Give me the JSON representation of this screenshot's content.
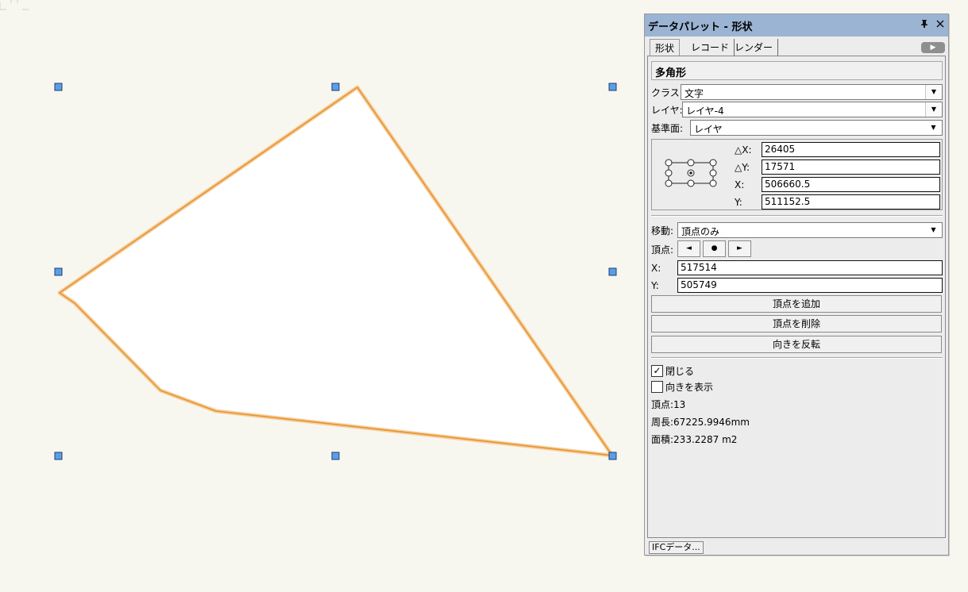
{
  "palette": {
    "title": "データパレット - 形状",
    "pin_icon": "pin-icon",
    "close_icon": "close-icon",
    "tabs": [
      {
        "label": "形状"
      },
      {
        "label": "レコード"
      },
      {
        "label": "レンダー"
      }
    ],
    "shape_name": "多角形",
    "class_label": "クラス:",
    "class_value": "文字",
    "layer_label": "レイヤ:",
    "layer_value": "レイヤ-4",
    "plane_label": "基準面:",
    "plane_value": "レイヤ",
    "coords": {
      "dx_label": "△X:",
      "dx_value": "26405",
      "dy_label": "△Y:",
      "dy_value": "17571",
      "x_label": "X:",
      "x_value": "506660.5",
      "y_label": "Y:",
      "y_value": "511152.5"
    },
    "move_label": "移動:",
    "move_value": "頂点のみ",
    "vertex_label": "頂点:",
    "vertex_prev": "◄",
    "vertex_current": "●",
    "vertex_next": "►",
    "vx_label": "X:",
    "vx_value": "517514",
    "vy_label": "Y:",
    "vy_value": "505749",
    "add_vertex": "頂点を追加",
    "delete_vertex": "頂点を削除",
    "reverse": "向きを反転",
    "closed_label": "閉じる",
    "closed_checked": true,
    "show_direction_label": "向きを表示",
    "show_direction_checked": false,
    "vertex_count": "頂点:13",
    "perimeter": "周長:67225.9946mm",
    "area": "面積:233.2287 m2",
    "ifc_button": "IFCデータ..."
  },
  "colors": {
    "canvas_bg": "#f8f7ef",
    "polygon_stroke": "#e8922e",
    "handle_fill": "#5b9ee6",
    "titlebar": "#9bb4d3"
  }
}
